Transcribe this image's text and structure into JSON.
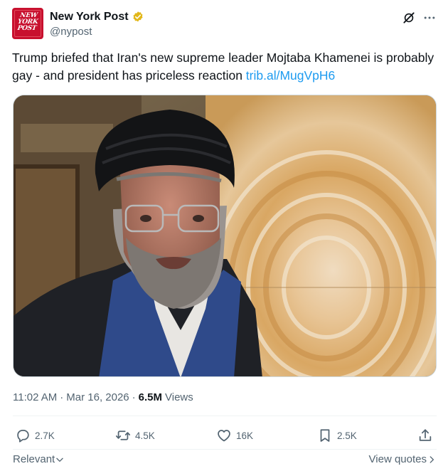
{
  "account": {
    "avatar_text_lines": [
      "NEW",
      "YORK",
      "POST"
    ],
    "display_name": "New York Post",
    "handle": "@nypost",
    "verified_color": "#e2b719"
  },
  "tweet": {
    "text": "Trump briefed that Iran's new supreme leader Mojtaba Khamenei is probably gay - and president has priceless reaction ",
    "link": "trib.al/MugVpH6"
  },
  "meta": {
    "time": "11:02 AM",
    "date": "Mar 16, 2026",
    "views_count": "6.5M",
    "views_label": "Views"
  },
  "actions": {
    "replies": "2.7K",
    "reposts": "4.5K",
    "likes": "16K",
    "bookmarks": "2.5K"
  },
  "footer": {
    "sort_label": "Relevant",
    "view_quotes": "View quotes"
  },
  "icons": {
    "grok": "grok-icon",
    "more": "more-dots-icon",
    "reply": "reply-icon",
    "repost": "repost-icon",
    "like": "heart-icon",
    "bookmark": "bookmark-icon",
    "share": "share-icon"
  },
  "colors": {
    "brand_red": "#c8102e",
    "link": "#1d9bf0",
    "secondary_text": "#536471"
  }
}
